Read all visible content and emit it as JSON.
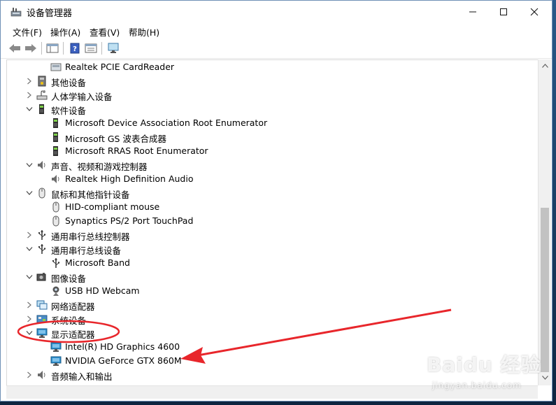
{
  "window": {
    "title": "设备管理器"
  },
  "menu": [
    {
      "id": "file",
      "label": "文件(F)"
    },
    {
      "id": "action",
      "label": "操作(A)"
    },
    {
      "id": "view",
      "label": "查看(V)"
    },
    {
      "id": "help",
      "label": "帮助(H)"
    }
  ],
  "tree": [
    {
      "level": 1,
      "state": "none",
      "icon": "card-reader-icon",
      "label": "Realtek PCIE CardReader"
    },
    {
      "level": 0,
      "state": "collapsed",
      "icon": "unknown-device-icon",
      "label": "其他设备"
    },
    {
      "level": 0,
      "state": "collapsed",
      "icon": "hid-icon",
      "label": "人体学输入设备"
    },
    {
      "level": 0,
      "state": "expanded",
      "icon": "software-device-icon",
      "label": "软件设备"
    },
    {
      "level": 1,
      "state": "none",
      "icon": "software-device-icon",
      "label": "Microsoft Device Association Root Enumerator"
    },
    {
      "level": 1,
      "state": "none",
      "icon": "software-device-icon",
      "label": "Microsoft GS 波表合成器"
    },
    {
      "level": 1,
      "state": "none",
      "icon": "software-device-icon",
      "label": "Microsoft RRAS Root Enumerator"
    },
    {
      "level": 0,
      "state": "expanded",
      "icon": "speaker-icon",
      "label": "声音、视频和游戏控制器"
    },
    {
      "level": 1,
      "state": "none",
      "icon": "speaker-icon",
      "label": "Realtek High Definition Audio"
    },
    {
      "level": 0,
      "state": "expanded",
      "icon": "mouse-icon",
      "label": "鼠标和其他指针设备"
    },
    {
      "level": 1,
      "state": "none",
      "icon": "mouse-icon",
      "label": "HID-compliant mouse"
    },
    {
      "level": 1,
      "state": "none",
      "icon": "mouse-icon",
      "label": "Synaptics PS/2 Port TouchPad"
    },
    {
      "level": 0,
      "state": "collapsed",
      "icon": "usb-icon",
      "label": "通用串行总线控制器"
    },
    {
      "level": 0,
      "state": "expanded",
      "icon": "usb-icon",
      "label": "通用串行总线设备"
    },
    {
      "level": 1,
      "state": "none",
      "icon": "usb-icon",
      "label": "Microsoft Band"
    },
    {
      "level": 0,
      "state": "expanded",
      "icon": "camera-icon",
      "label": "图像设备"
    },
    {
      "level": 1,
      "state": "none",
      "icon": "webcam-icon",
      "label": "USB HD Webcam"
    },
    {
      "level": 0,
      "state": "collapsed",
      "icon": "network-icon",
      "label": "网络适配器"
    },
    {
      "level": 0,
      "state": "collapsed",
      "icon": "system-icon",
      "label": "系统设备"
    },
    {
      "level": 0,
      "state": "expanded",
      "icon": "display-icon",
      "label": "显示适配器"
    },
    {
      "level": 1,
      "state": "none",
      "icon": "display-icon",
      "label": "Intel(R) HD Graphics 4600"
    },
    {
      "level": 1,
      "state": "none",
      "icon": "display-icon",
      "label": "NVIDIA GeForce GTX 860M"
    },
    {
      "level": 0,
      "state": "collapsed",
      "icon": "audio-io-icon",
      "label": "音频输入和输出"
    }
  ],
  "colors": {
    "annotation": "#e8262b",
    "window_border": "#6e8fb5"
  },
  "watermark": {
    "text": "Baidu 经验",
    "sub": "jingyan.baidu.com"
  }
}
